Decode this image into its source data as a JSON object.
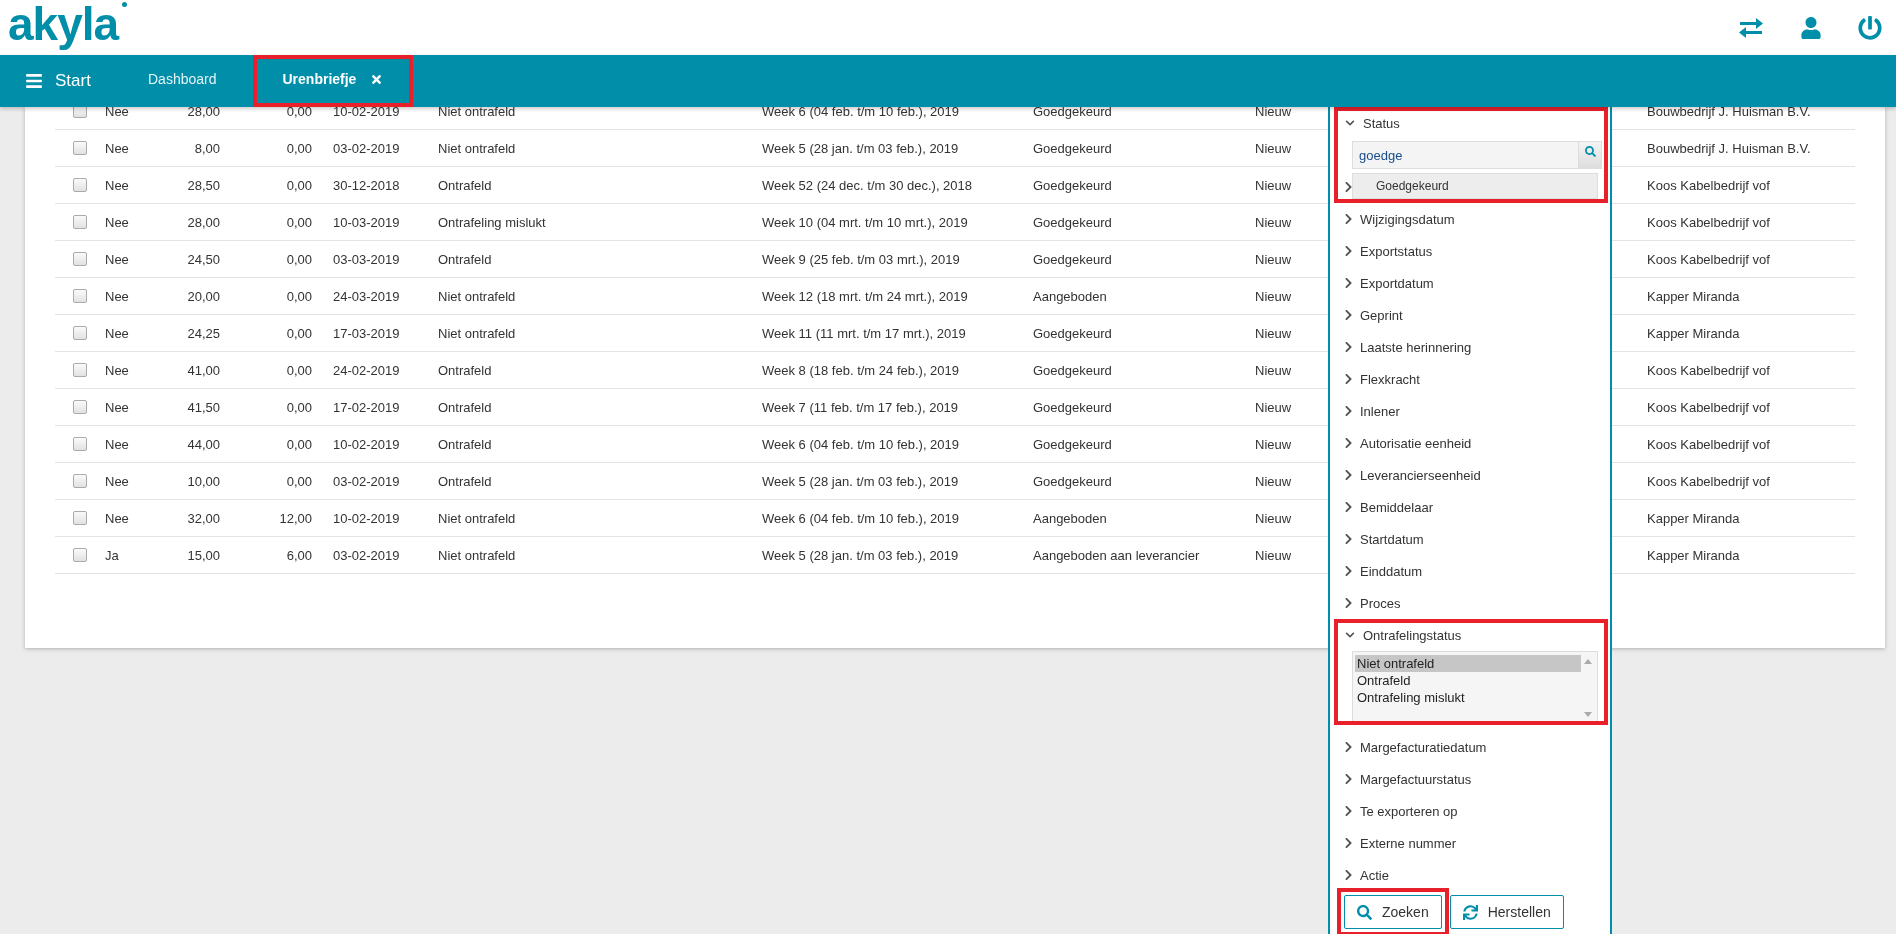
{
  "header": {
    "logo": "akyla"
  },
  "nav": {
    "menu_label": "Start",
    "tabs": [
      {
        "label": "Dashboard",
        "selected": false,
        "closable": false,
        "highlighted": false
      },
      {
        "label": "Urenbriefje",
        "selected": true,
        "closable": true,
        "highlighted": true
      }
    ]
  },
  "table": {
    "rows": [
      {
        "checked": false,
        "cells": [
          "Nee",
          "28,00",
          "0,00",
          "10-02-2019",
          "Niet ontrafeld",
          "Week 6 (04 feb. t/m 10 feb.), 2019",
          "Goedgekeurd",
          "Nieuw",
          "Bouwbedrijf J. Huisman B.V."
        ]
      },
      {
        "checked": false,
        "cells": [
          "Nee",
          "8,00",
          "0,00",
          "03-02-2019",
          "Niet ontrafeld",
          "Week 5 (28 jan. t/m 03 feb.), 2019",
          "Goedgekeurd",
          "Nieuw",
          "Bouwbedrijf J. Huisman B.V."
        ]
      },
      {
        "checked": false,
        "cells": [
          "Nee",
          "28,50",
          "0,00",
          "30-12-2018",
          "Ontrafeld",
          "Week 52 (24 dec. t/m 30 dec.), 2018",
          "Goedgekeurd",
          "Nieuw",
          "Koos Kabelbedrijf vof"
        ]
      },
      {
        "checked": false,
        "cells": [
          "Nee",
          "28,00",
          "0,00",
          "10-03-2019",
          "Ontrafeling mislukt",
          "Week 10 (04 mrt. t/m 10 mrt.), 2019",
          "Goedgekeurd",
          "Nieuw",
          "Koos Kabelbedrijf vof"
        ]
      },
      {
        "checked": false,
        "cells": [
          "Nee",
          "24,50",
          "0,00",
          "03-03-2019",
          "Ontrafeld",
          "Week 9 (25 feb. t/m 03 mrt.), 2019",
          "Goedgekeurd",
          "Nieuw",
          "Koos Kabelbedrijf vof"
        ]
      },
      {
        "checked": false,
        "cells": [
          "Nee",
          "20,00",
          "0,00",
          "24-03-2019",
          "Niet ontrafeld",
          "Week 12 (18 mrt. t/m 24 mrt.), 2019",
          "Aangeboden",
          "Nieuw",
          "Kapper Miranda"
        ]
      },
      {
        "checked": false,
        "cells": [
          "Nee",
          "24,25",
          "0,00",
          "17-03-2019",
          "Niet ontrafeld",
          "Week 11 (11 mrt. t/m 17 mrt.), 2019",
          "Goedgekeurd",
          "Nieuw",
          "Kapper Miranda"
        ]
      },
      {
        "checked": false,
        "cells": [
          "Nee",
          "41,00",
          "0,00",
          "24-02-2019",
          "Ontrafeld",
          "Week 8 (18 feb. t/m 24 feb.), 2019",
          "Goedgekeurd",
          "Nieuw",
          "Koos Kabelbedrijf vof"
        ]
      },
      {
        "checked": false,
        "cells": [
          "Nee",
          "41,50",
          "0,00",
          "17-02-2019",
          "Ontrafeld",
          "Week 7 (11 feb. t/m 17 feb.), 2019",
          "Goedgekeurd",
          "Nieuw",
          "Koos Kabelbedrijf vof"
        ]
      },
      {
        "checked": false,
        "cells": [
          "Nee",
          "44,00",
          "0,00",
          "10-02-2019",
          "Ontrafeld",
          "Week 6 (04 feb. t/m 10 feb.), 2019",
          "Goedgekeurd",
          "Nieuw",
          "Koos Kabelbedrijf vof"
        ]
      },
      {
        "checked": false,
        "cells": [
          "Nee",
          "10,00",
          "0,00",
          "03-02-2019",
          "Ontrafeld",
          "Week 5 (28 jan. t/m 03 feb.), 2019",
          "Goedgekeurd",
          "Nieuw",
          "Koos Kabelbedrijf vof"
        ]
      },
      {
        "checked": false,
        "cells": [
          "Nee",
          "32,00",
          "12,00",
          "10-02-2019",
          "Niet ontrafeld",
          "Week 6 (04 feb. t/m 10 feb.), 2019",
          "Aangeboden",
          "Nieuw",
          "Kapper Miranda"
        ]
      },
      {
        "checked": false,
        "cells": [
          "Ja",
          "15,00",
          "6,00",
          "03-02-2019",
          "Niet ontrafeld",
          "Week 5 (28 jan. t/m 03 feb.), 2019",
          "Aangeboden aan leverancier",
          "Nieuw",
          "Kapper Miranda"
        ]
      }
    ]
  },
  "filter_panel": {
    "sections": [
      {
        "kind": "search",
        "label": "Status",
        "expanded": true,
        "highlighted": true,
        "value": "goedge",
        "suggestions": [
          "Goedgekeurd"
        ]
      },
      {
        "kind": "collapsed",
        "label": "Wijzigingsdatum"
      },
      {
        "kind": "collapsed",
        "label": "Exportstatus"
      },
      {
        "kind": "collapsed",
        "label": "Exportdatum"
      },
      {
        "kind": "collapsed",
        "label": "Geprint"
      },
      {
        "kind": "collapsed",
        "label": "Laatste herinnering"
      },
      {
        "kind": "collapsed",
        "label": "Flexkracht"
      },
      {
        "kind": "collapsed",
        "label": "Inlener"
      },
      {
        "kind": "collapsed",
        "label": "Autorisatie eenheid"
      },
      {
        "kind": "collapsed",
        "label": "Leverancierseenheid"
      },
      {
        "kind": "collapsed",
        "label": "Bemiddelaar"
      },
      {
        "kind": "collapsed",
        "label": "Startdatum"
      },
      {
        "kind": "collapsed",
        "label": "Einddatum"
      },
      {
        "kind": "collapsed",
        "label": "Proces"
      },
      {
        "kind": "listbox",
        "label": "Ontrafelingstatus",
        "expanded": true,
        "highlighted": true,
        "options": [
          {
            "label": "Niet ontrafeld",
            "selected": true
          },
          {
            "label": "Ontrafeld",
            "selected": false
          },
          {
            "label": "Ontrafeling mislukt",
            "selected": false
          }
        ]
      },
      {
        "kind": "collapsed",
        "label": "Margefacturatiedatum"
      },
      {
        "kind": "collapsed",
        "label": "Margefactuurstatus"
      },
      {
        "kind": "collapsed",
        "label": "Te exporteren op"
      },
      {
        "kind": "collapsed",
        "label": "Externe nummer"
      },
      {
        "kind": "collapsed",
        "label": "Actie"
      }
    ],
    "buttons": [
      {
        "label": "Zoeken",
        "highlighted": true
      },
      {
        "label": "Herstellen",
        "highlighted": false
      }
    ]
  }
}
